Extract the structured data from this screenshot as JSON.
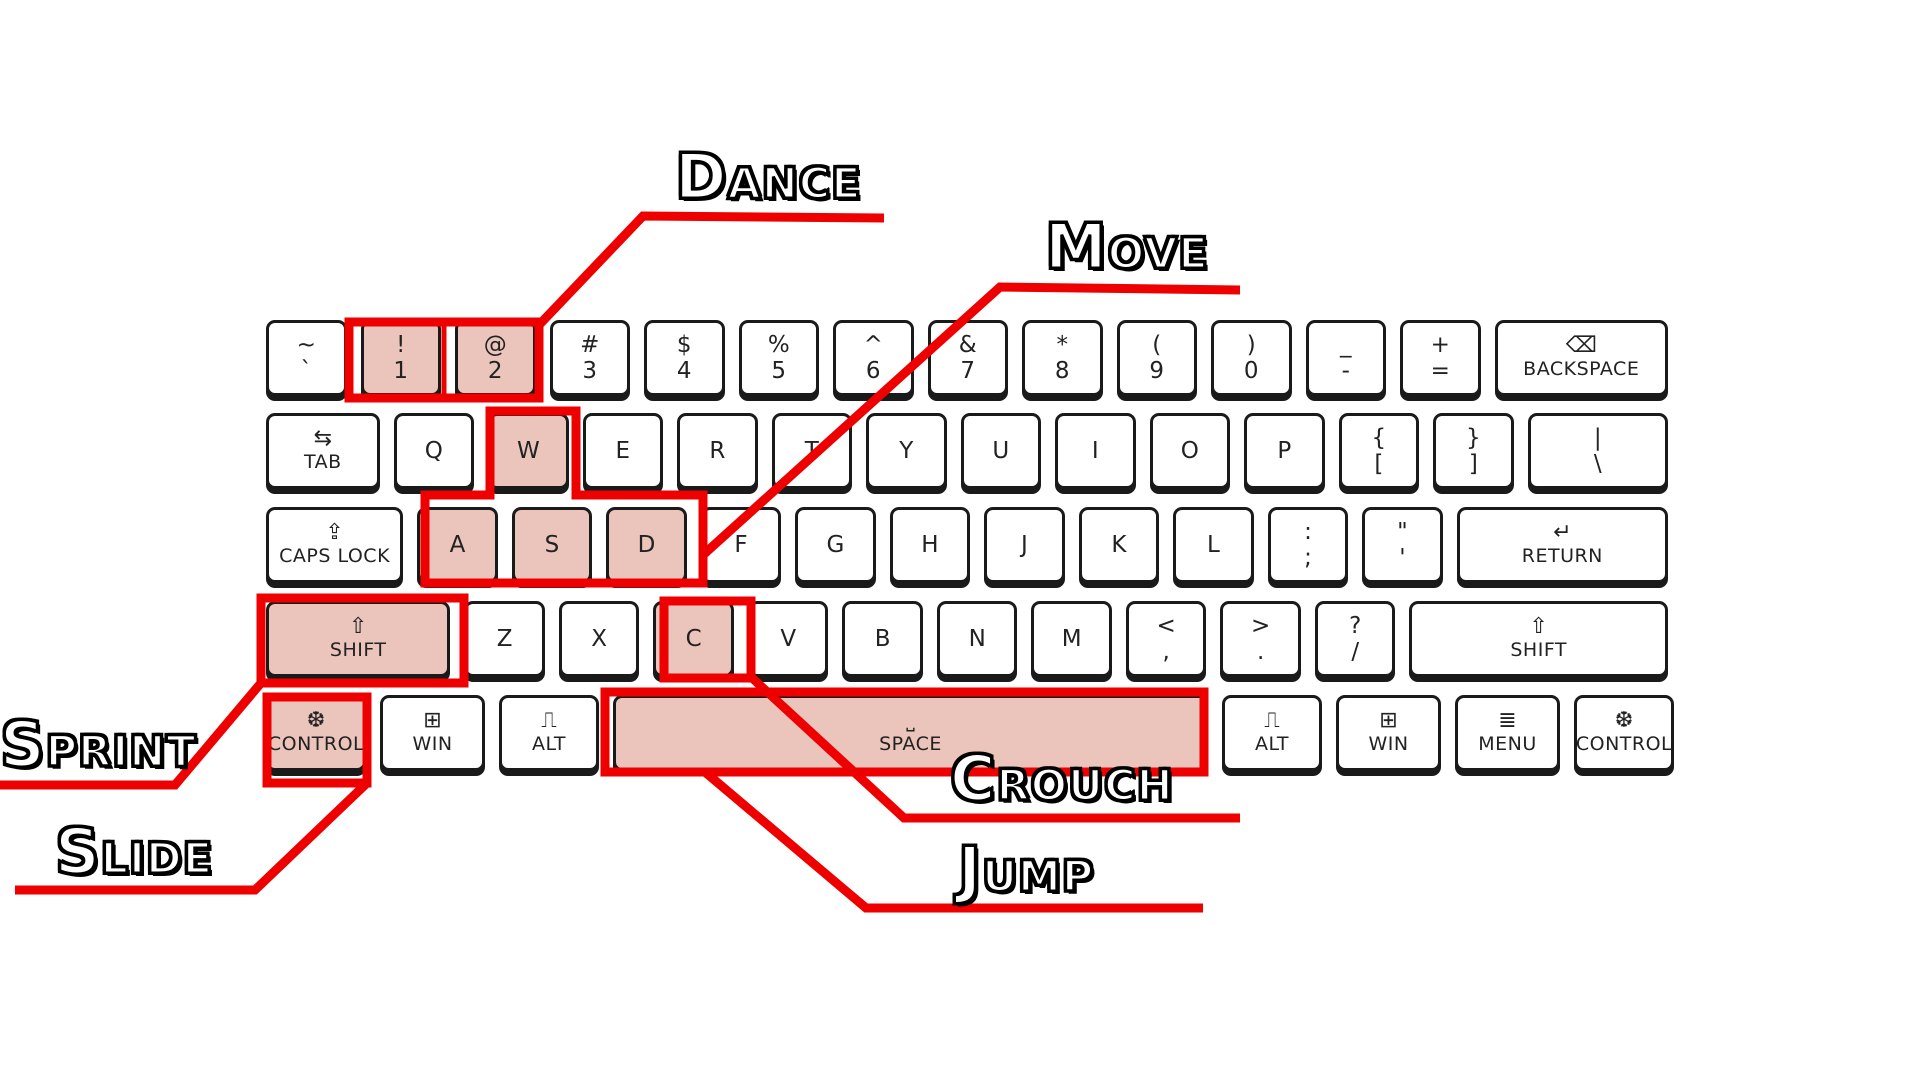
{
  "keyboard": {
    "row1": [
      {
        "id": "tilde",
        "top": "~",
        "bot": "`"
      },
      {
        "id": "1",
        "top": "!",
        "bot": "1",
        "hl": true
      },
      {
        "id": "2",
        "top": "@",
        "bot": "2",
        "hl": true
      },
      {
        "id": "3",
        "top": "#",
        "bot": "3"
      },
      {
        "id": "4",
        "top": "$",
        "bot": "4"
      },
      {
        "id": "5",
        "top": "%",
        "bot": "5"
      },
      {
        "id": "6",
        "top": "^",
        "bot": "6"
      },
      {
        "id": "7",
        "top": "&",
        "bot": "7"
      },
      {
        "id": "8",
        "top": "*",
        "bot": "8"
      },
      {
        "id": "9",
        "top": "(",
        "bot": "9"
      },
      {
        "id": "0",
        "top": ")",
        "bot": "0"
      },
      {
        "id": "minus",
        "top": "_",
        "bot": "-"
      },
      {
        "id": "equals",
        "top": "+",
        "bot": "="
      },
      {
        "id": "backspace",
        "icon": "⌫",
        "word": "BACKSPACE"
      }
    ],
    "row2": [
      {
        "id": "tab",
        "icon": "⇆",
        "word": "TAB"
      },
      {
        "id": "q",
        "letter": "Q"
      },
      {
        "id": "w",
        "letter": "W",
        "hl": true
      },
      {
        "id": "e",
        "letter": "E"
      },
      {
        "id": "r",
        "letter": "R"
      },
      {
        "id": "t",
        "letter": "T"
      },
      {
        "id": "y",
        "letter": "Y"
      },
      {
        "id": "u",
        "letter": "U"
      },
      {
        "id": "i",
        "letter": "I"
      },
      {
        "id": "o",
        "letter": "O"
      },
      {
        "id": "p",
        "letter": "P"
      },
      {
        "id": "lbracket",
        "top": "{",
        "bot": "["
      },
      {
        "id": "rbracket",
        "top": "}",
        "bot": "]"
      },
      {
        "id": "backslash",
        "top": "|",
        "bot": "\\"
      }
    ],
    "row3": [
      {
        "id": "capslock",
        "icon": "⇪",
        "word": "CAPS LOCK"
      },
      {
        "id": "a",
        "letter": "A",
        "hl": true
      },
      {
        "id": "s",
        "letter": "S",
        "hl": true
      },
      {
        "id": "d",
        "letter": "D",
        "hl": true
      },
      {
        "id": "f",
        "letter": "F"
      },
      {
        "id": "g",
        "letter": "G"
      },
      {
        "id": "h",
        "letter": "H"
      },
      {
        "id": "j",
        "letter": "J"
      },
      {
        "id": "k",
        "letter": "K"
      },
      {
        "id": "l",
        "letter": "L"
      },
      {
        "id": "semicolon",
        "top": ":",
        "bot": ";"
      },
      {
        "id": "quote",
        "top": "\"",
        "bot": "'"
      },
      {
        "id": "return",
        "icon": "↵",
        "word": "RETURN"
      }
    ],
    "row4": [
      {
        "id": "lshift",
        "icon": "⇧",
        "word": "SHIFT",
        "hl": true
      },
      {
        "id": "z",
        "letter": "Z"
      },
      {
        "id": "x",
        "letter": "X"
      },
      {
        "id": "c",
        "letter": "C",
        "hl": true
      },
      {
        "id": "v",
        "letter": "V"
      },
      {
        "id": "b",
        "letter": "B"
      },
      {
        "id": "n",
        "letter": "N"
      },
      {
        "id": "m",
        "letter": "M"
      },
      {
        "id": "comma",
        "top": "<",
        "bot": ","
      },
      {
        "id": "period",
        "top": ">",
        "bot": "."
      },
      {
        "id": "slash",
        "top": "?",
        "bot": "/"
      },
      {
        "id": "rshift",
        "icon": "⇧",
        "word": "SHIFT"
      }
    ],
    "row5": [
      {
        "id": "lcontrol",
        "icon": "❆",
        "word": "CONTROL",
        "hl": true
      },
      {
        "id": "lwin",
        "icon": "⊞",
        "word": "WIN"
      },
      {
        "id": "lalt",
        "icon": "⎍",
        "word": "ALT"
      },
      {
        "id": "space",
        "icon": "˽",
        "word": "SPACE",
        "hl": true
      },
      {
        "id": "ralt",
        "icon": "⎍",
        "word": "ALT"
      },
      {
        "id": "rwin",
        "icon": "⊞",
        "word": "WIN"
      },
      {
        "id": "menu",
        "icon": "≣",
        "word": "MENU"
      },
      {
        "id": "rcontrol",
        "icon": "❆",
        "word": "CONTROL"
      }
    ]
  },
  "labels": {
    "dance": "Dance",
    "move": "Move",
    "sprint": "Sprint",
    "slide": "Slide",
    "crouch": "Crouch",
    "jump": "Jump"
  },
  "colors": {
    "highlight_fill": "#ebc4bc",
    "annotation_red": "#ee0000",
    "key_border": "#1a1a1a"
  }
}
